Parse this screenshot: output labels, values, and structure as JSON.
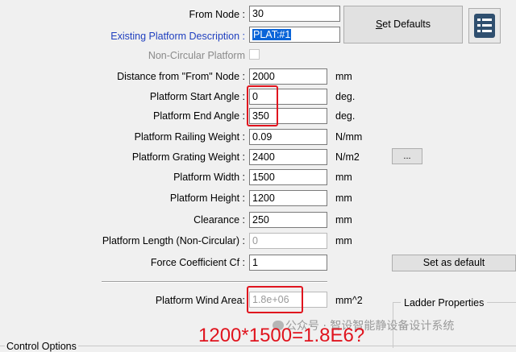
{
  "fields": [
    {
      "id": "from_node",
      "label": "From Node :",
      "value": "30",
      "unit": "",
      "style": "normal"
    },
    {
      "id": "existing_desc",
      "label": "Existing Platform Description :",
      "value": "PLAT:#1",
      "unit": "",
      "style": "blue"
    },
    {
      "id": "non_circular",
      "label": "Non-Circular Platform",
      "value": "",
      "unit": "",
      "style": "gray"
    },
    {
      "id": "distance",
      "label": "Distance from \"From\" Node :",
      "value": "2000",
      "unit": "mm",
      "style": "normal"
    },
    {
      "id": "start_angle",
      "label": "Platform Start Angle :",
      "value": "0",
      "unit": "deg.",
      "style": "normal"
    },
    {
      "id": "end_angle",
      "label": "Platform End Angle :",
      "value": "350",
      "unit": "deg.",
      "style": "normal"
    },
    {
      "id": "railing_weight",
      "label": "Platform Railing Weight :",
      "value": "0.09",
      "unit": "N/mm",
      "style": "normal"
    },
    {
      "id": "grating_weight",
      "label": "Platform Grating Weight :",
      "value": "2400",
      "unit": "N/m2",
      "style": "normal"
    },
    {
      "id": "width",
      "label": "Platform Width :",
      "value": "1500",
      "unit": "mm",
      "style": "normal"
    },
    {
      "id": "height",
      "label": "Platform Height :",
      "value": "1200",
      "unit": "mm",
      "style": "normal"
    },
    {
      "id": "clearance",
      "label": "Clearance :",
      "value": "250",
      "unit": "mm",
      "style": "normal"
    },
    {
      "id": "length_noncirc",
      "label": "Platform Length (Non-Circular) :",
      "value": "0",
      "unit": "mm",
      "style": "normal"
    },
    {
      "id": "force_coeff",
      "label": "Force Coefficient Cf :",
      "value": "1",
      "unit": "",
      "style": "normal"
    },
    {
      "id": "wind_area",
      "label": "Platform Wind Area:",
      "value": "1.8e+06",
      "unit": "mm^2",
      "style": "normal"
    }
  ],
  "buttons": {
    "set_defaults": "Set Defaults",
    "set_defaults_mnemonic": "S",
    "set_defaults_rest": "et Defaults",
    "ellipsis": "...",
    "set_as_default": "Set as default"
  },
  "groups": {
    "ladder_properties": "Ladder Properties",
    "control_options": "Control Options"
  },
  "annotation": {
    "text": "1200*1500=1.8E6?",
    "color": "#e0141e"
  },
  "watermark": "公众号 · 智设智能静设备设计系统",
  "colors": {
    "highlight": "#0a64d8",
    "blue_label": "#1f3fbf",
    "annotation_red": "#e0141e"
  }
}
